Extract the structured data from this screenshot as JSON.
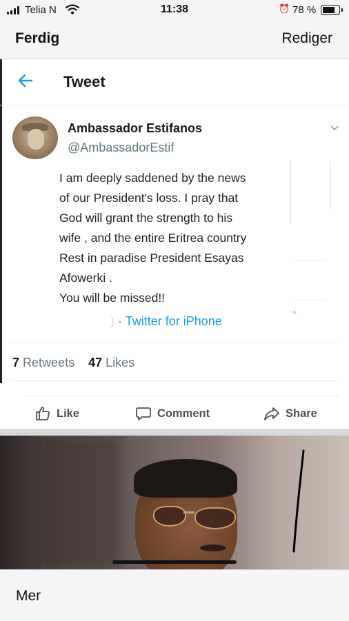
{
  "status_bar": {
    "carrier": "Telia N",
    "time": "11:38",
    "battery_percent": "78 %",
    "icons": [
      "signal-icon",
      "wifi-icon",
      "alarm-icon",
      "battery-icon"
    ]
  },
  "nav": {
    "done_label": "Ferdig",
    "edit_label": "Rediger"
  },
  "tweet_header": {
    "title": "Tweet",
    "back_icon": "back-arrow-icon"
  },
  "tweet": {
    "author_name": "Ambassador Estifanos",
    "author_handle": "@AmbassadorEstif",
    "text_lines": [
      "I am deeply saddened by the news",
      "of our President's loss. I pray that",
      "God will grant the strength  to his",
      "wife , and the entire Eritrea country",
      "Rest in paradise President Esayas",
      "Afowerki .",
      "You will be missed!!"
    ],
    "source": "Twitter for iPhone",
    "retweets_count": "7",
    "retweets_label": "Retweets",
    "likes_count": "47",
    "likes_label": "Likes"
  },
  "actions": {
    "like_label": "Like",
    "comment_label": "Comment",
    "share_label": "Share"
  },
  "bottom": {
    "more_label": "Mer"
  },
  "colors": {
    "twitter_blue": "#1d9bf0",
    "muted_gray": "#66757f",
    "action_gray": "#4b4f56"
  }
}
